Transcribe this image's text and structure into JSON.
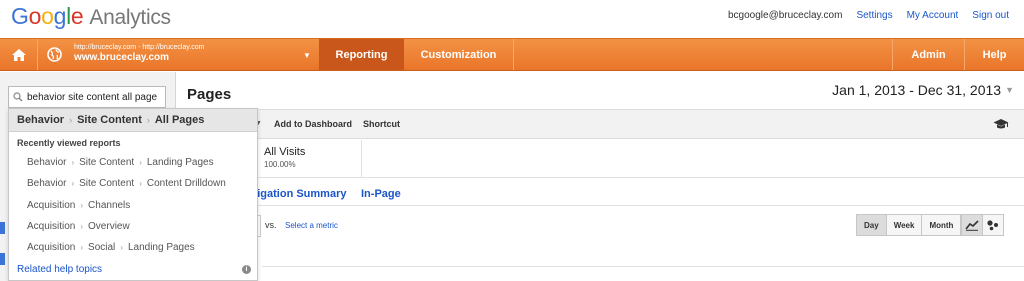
{
  "header": {
    "logo_google": [
      "G",
      "o",
      "o",
      "g",
      "l",
      "e"
    ],
    "logo_analytics": "Analytics",
    "email": "bcgoogle@bruceclay.com",
    "links": [
      "Settings",
      "My Account",
      "Sign out"
    ]
  },
  "nav": {
    "account_small": "http://bruceclay.com - http://bruceclay.com",
    "account_big": "www.bruceclay.com",
    "reporting": "Reporting",
    "customization": "Customization",
    "admin": "Admin",
    "help": "Help"
  },
  "sidebar": {
    "search_value": "behavior site content all page"
  },
  "dropdown": {
    "top": [
      "Behavior",
      "Site Content",
      "All Pages"
    ],
    "heading": "Recently viewed reports",
    "items": [
      [
        "Behavior",
        "Site Content",
        "Landing Pages"
      ],
      [
        "Behavior",
        "Site Content",
        "Content Drilldown"
      ],
      [
        "Acquisition",
        "Channels"
      ],
      [
        "Acquisition",
        "Overview"
      ],
      [
        "Acquisition",
        "Social",
        "Landing Pages"
      ]
    ],
    "help_link": "Related help topics",
    "info_icon": "i"
  },
  "main": {
    "title": "Pages",
    "date_range": "Jan 1, 2013 - Dec 31, 2013",
    "toolbar": {
      "add_to_dashboard": "Add to Dashboard",
      "shortcut": "Shortcut"
    },
    "summary": {
      "label": "All Visits",
      "percent": "100.00%"
    },
    "subtabs": [
      "avigation Summary",
      "In-Page"
    ],
    "vs": "vs.",
    "select_metric": "Select a metric",
    "granularity": [
      "Day",
      "Week",
      "Month"
    ],
    "icons": {
      "home": "home-icon",
      "globe": "globe-icon",
      "search": "search-icon",
      "graduation": "graduation-cap-icon",
      "line_chart": "line-chart-icon",
      "motion_chart": "motion-chart-icon"
    }
  },
  "colors": {
    "nav_orange": "#e9752a",
    "nav_active": "#c9561a",
    "link_blue": "#1a55c9"
  }
}
